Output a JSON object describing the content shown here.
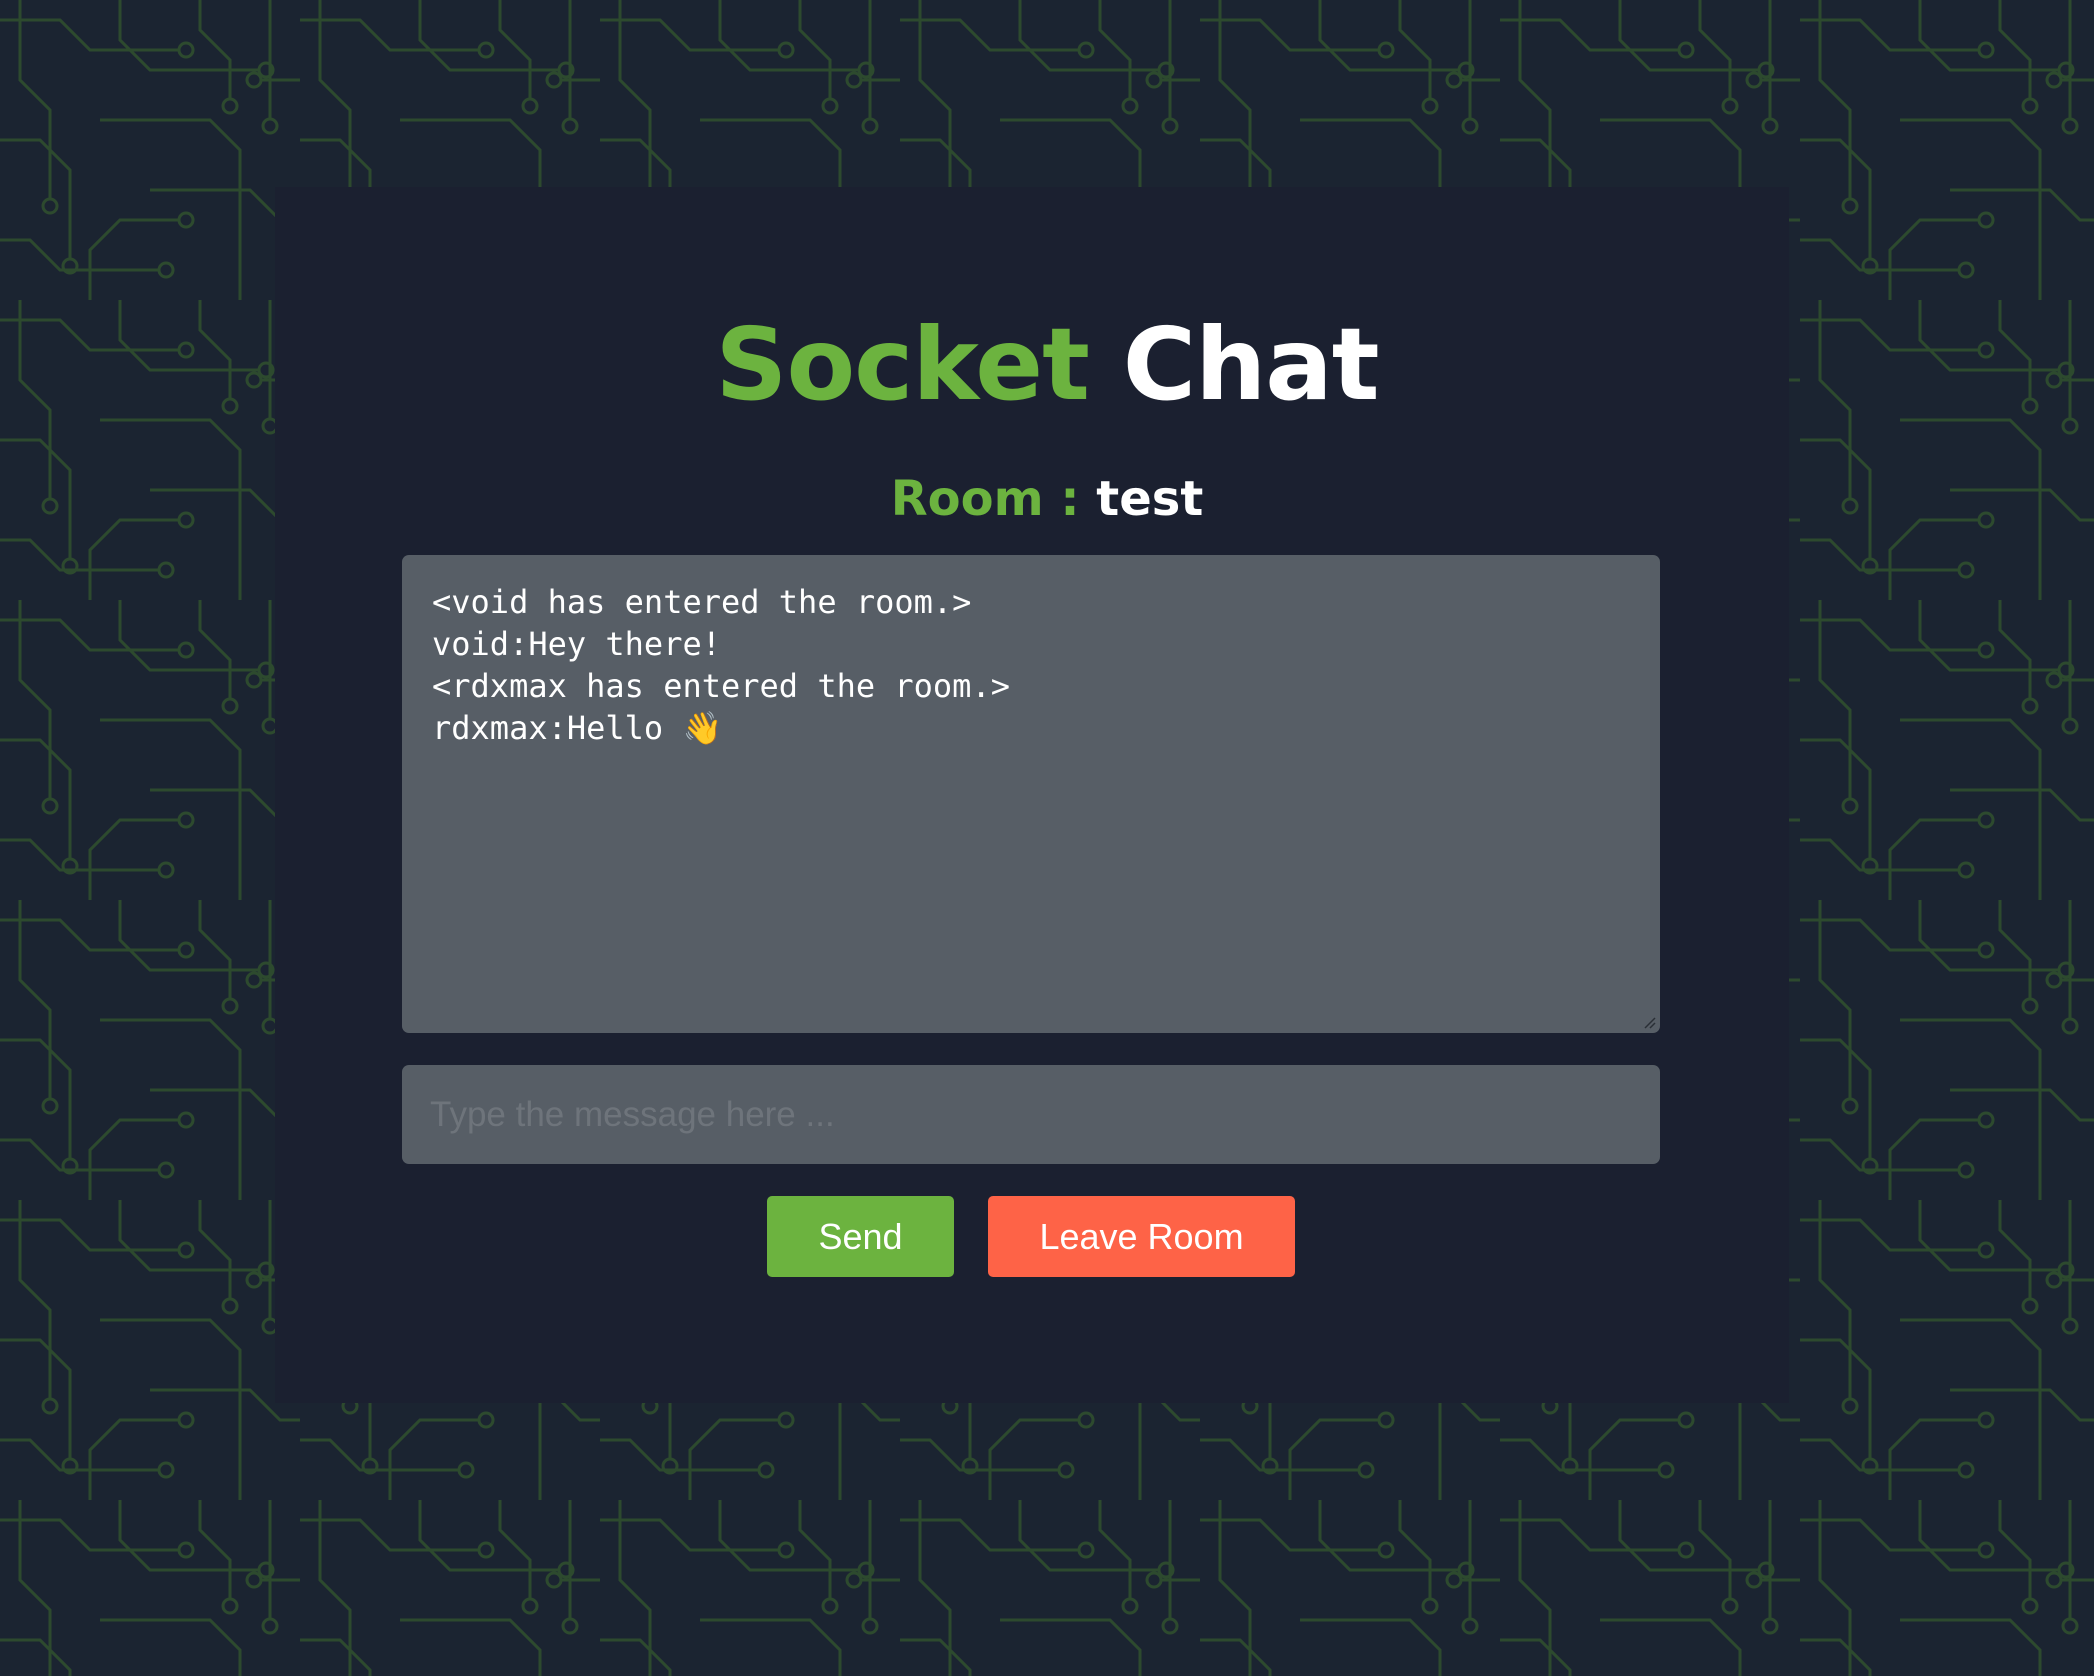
{
  "app": {
    "title_accent": "Socket",
    "title_rest": "Chat"
  },
  "room": {
    "label": "Room :",
    "name": "test"
  },
  "chat": {
    "messages": [
      "<void has entered the room.>",
      "void:Hey there!",
      "<rdxmax has entered the room.>",
      "rdxmax:Hello 👋"
    ]
  },
  "composer": {
    "placeholder": "Type the message here ...",
    "value": "",
    "send_label": "Send",
    "leave_label": "Leave Room"
  },
  "colors": {
    "accent_green": "#6cb33f",
    "leave_red": "#fe6347",
    "background": "#1b2431",
    "input_gray": "#575e66"
  }
}
